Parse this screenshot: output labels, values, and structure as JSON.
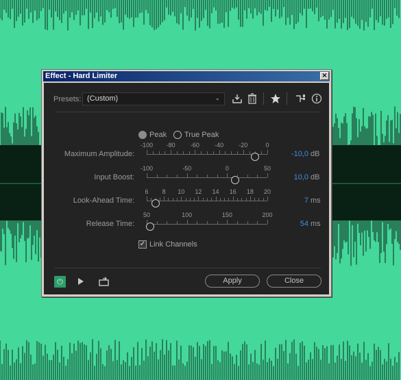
{
  "dialog": {
    "title": "Effect - Hard Limiter",
    "close_glyph": "×"
  },
  "presets": {
    "label": "Presets:",
    "value": "(Custom)",
    "icons": [
      "save-preset-icon",
      "delete-preset-icon",
      "favorite-star-icon",
      "routing-icon",
      "info-icon"
    ]
  },
  "mode": {
    "options": [
      {
        "label": "Peak",
        "selected": true
      },
      {
        "label": "True Peak",
        "selected": false
      }
    ]
  },
  "params": [
    {
      "label": "Maximum Amplitude:",
      "scale": [
        "-100",
        "-80",
        "-60",
        "-40",
        "-20",
        "0"
      ],
      "min": -100,
      "max": 0,
      "value": -10,
      "value_text": "-10,0",
      "unit": "dB"
    },
    {
      "label": "Input Boost:",
      "scale": [
        "-100",
        "-50",
        "0",
        "50"
      ],
      "min": -100,
      "max": 50,
      "value": 10,
      "value_text": "10,0",
      "unit": "dB"
    },
    {
      "label": "Look-Ahead Time:",
      "scale": [
        "6",
        "8",
        "10",
        "12",
        "14",
        "16",
        "18",
        "20"
      ],
      "min": 6,
      "max": 20,
      "value": 7,
      "value_text": "7",
      "unit": "ms"
    },
    {
      "label": "Release Time:",
      "scale": [
        "50",
        "100",
        "150",
        "200"
      ],
      "min": 50,
      "max": 200,
      "value": 54,
      "value_text": "54",
      "unit": "ms"
    }
  ],
  "link_channels": {
    "label": "Link Channels",
    "checked": true
  },
  "footer": {
    "apply_label": "Apply",
    "close_label": "Close"
  },
  "colors": {
    "background": "#44d89a",
    "accent_value": "#3d8fe0",
    "power_on": "#2e9c6a"
  }
}
